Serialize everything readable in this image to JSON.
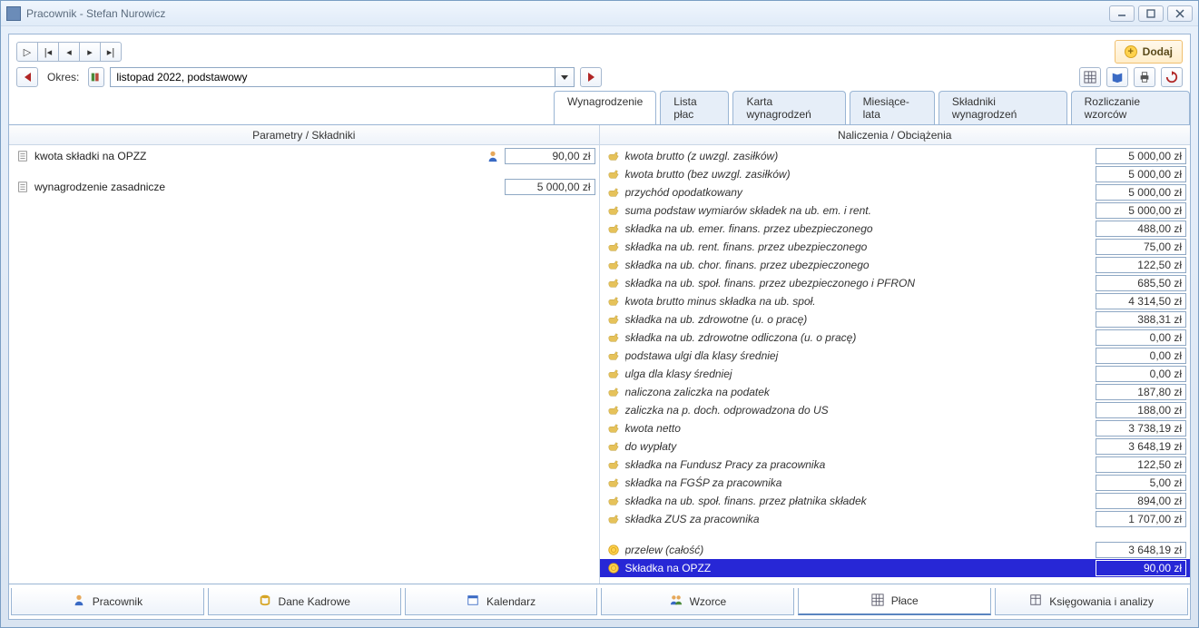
{
  "window": {
    "title": "Pracownik - Stefan Nurowicz"
  },
  "toolbar": {
    "add_label": "Dodaj",
    "period_label": "Okres:",
    "period_value": "listopad 2022, podstawowy"
  },
  "tabs": [
    {
      "label": "Wynagrodzenie",
      "active": true
    },
    {
      "label": "Lista płac"
    },
    {
      "label": "Karta wynagrodzeń"
    },
    {
      "label": "Miesiące-lata"
    },
    {
      "label": "Składniki wynagrodzeń"
    },
    {
      "label": "Rozliczanie wzorców"
    }
  ],
  "columns": {
    "left": "Parametry / Składniki",
    "right": "Naliczenia / Obciążenia"
  },
  "left_rows": [
    {
      "icon": "doc",
      "label": "kwota składki na OPZZ",
      "person": true,
      "value": "90,00 zł"
    },
    {
      "spacer": true
    },
    {
      "icon": "doc",
      "label": "wynagrodzenie zasadnicze",
      "value": "5 000,00 zł"
    }
  ],
  "right_rows": [
    {
      "icon": "hand",
      "label": "kwota brutto (z uwzgl. zasiłków)",
      "italic": true,
      "value": "5 000,00 zł"
    },
    {
      "icon": "hand",
      "label": "kwota brutto (bez uwzgl. zasiłków)",
      "italic": true,
      "value": "5 000,00 zł"
    },
    {
      "icon": "hand",
      "label": "przychód opodatkowany",
      "italic": true,
      "value": "5 000,00 zł"
    },
    {
      "icon": "hand",
      "label": "suma podstaw wymiarów składek na ub. em. i rent.",
      "italic": true,
      "value": "5 000,00 zł"
    },
    {
      "icon": "hand",
      "label": "składka na ub. emer. finans. przez ubezpieczonego",
      "italic": true,
      "value": "488,00 zł"
    },
    {
      "icon": "hand",
      "label": "składka na ub. rent. finans. przez ubezpieczonego",
      "italic": true,
      "value": "75,00 zł"
    },
    {
      "icon": "hand",
      "label": "składka na ub. chor. finans. przez ubezpieczonego",
      "italic": true,
      "value": "122,50 zł"
    },
    {
      "icon": "hand",
      "label": "składka na ub. społ. finans. przez ubezpieczonego i PFRON",
      "italic": true,
      "value": "685,50 zł"
    },
    {
      "icon": "hand",
      "label": "kwota brutto minus składka na ub. społ.",
      "italic": true,
      "value": "4 314,50 zł"
    },
    {
      "icon": "hand",
      "label": "składka na ub. zdrowotne (u. o pracę)",
      "italic": true,
      "value": "388,31 zł"
    },
    {
      "icon": "hand",
      "label": "składka na ub. zdrowotne odliczona (u. o pracę)",
      "italic": true,
      "value": "0,00 zł"
    },
    {
      "icon": "hand",
      "label": "podstawa ulgi dla klasy średniej",
      "italic": true,
      "value": "0,00 zł"
    },
    {
      "icon": "hand",
      "label": "ulga dla klasy średniej",
      "italic": true,
      "value": "0,00 zł"
    },
    {
      "icon": "hand",
      "label": "naliczona zaliczka na podatek",
      "italic": true,
      "value": "187,80 zł"
    },
    {
      "icon": "hand",
      "label": "zaliczka na p. doch. odprowadzona do US",
      "italic": true,
      "value": "188,00 zł"
    },
    {
      "icon": "hand",
      "label": "kwota netto",
      "italic": true,
      "value": "3 738,19 zł"
    },
    {
      "icon": "hand",
      "label": "do wypłaty",
      "italic": true,
      "value": "3 648,19 zł"
    },
    {
      "icon": "hand",
      "label": "składka na Fundusz Pracy za pracownika",
      "italic": true,
      "value": "122,50 zł"
    },
    {
      "icon": "hand",
      "label": "składka na FGŚP za pracownika",
      "italic": true,
      "value": "5,00 zł"
    },
    {
      "icon": "hand",
      "label": "składka na ub. społ. finans. przez płatnika składek",
      "italic": true,
      "value": "894,00 zł"
    },
    {
      "icon": "hand",
      "label": "składka ZUS za pracownika",
      "italic": true,
      "value": "1 707,00 zł"
    },
    {
      "spacer": true
    },
    {
      "icon": "coin",
      "label": "przelew (całość)",
      "italic": true,
      "value": "3 648,19 zł"
    },
    {
      "icon": "coin",
      "label": "Składka na OPZZ",
      "value": "90,00 zł",
      "selected": true
    }
  ],
  "bottom_tabs": [
    {
      "icon": "person",
      "label": "Pracownik"
    },
    {
      "icon": "db",
      "label": "Dane Kadrowe"
    },
    {
      "icon": "cal",
      "label": "Kalendarz"
    },
    {
      "icon": "two",
      "label": "Wzorce"
    },
    {
      "icon": "table",
      "label": "Płace",
      "active": true
    },
    {
      "icon": "book",
      "label": "Księgowania i analizy"
    }
  ]
}
